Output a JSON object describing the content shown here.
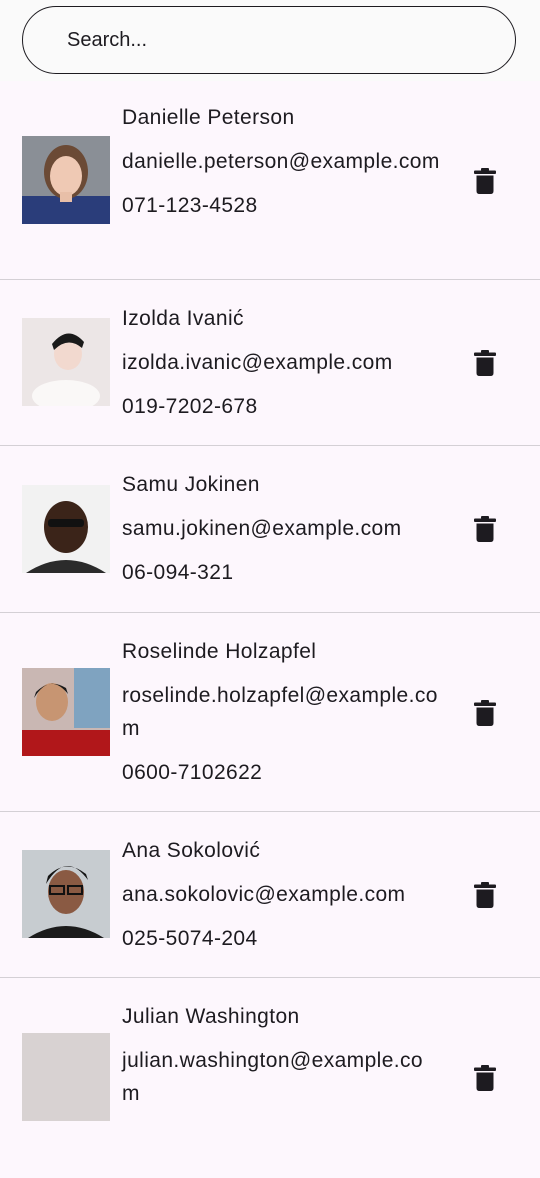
{
  "search": {
    "placeholder": "Search..."
  },
  "contacts": [
    {
      "name": "Danielle Peterson",
      "email": "danielle.peterson@example.com",
      "phone": "071-123-4528"
    },
    {
      "name": "Izolda Ivanić",
      "email": "izolda.ivanic@example.com",
      "phone": "019-7202-678"
    },
    {
      "name": "Samu Jokinen",
      "email": "samu.jokinen@example.com",
      "phone": "06-094-321"
    },
    {
      "name": "Roselinde Holzapfel",
      "email": "roselinde.holzapfel@example.com",
      "phone": "0600-7102622"
    },
    {
      "name": "Ana Sokolović",
      "email": "ana.sokolovic@example.com",
      "phone": "025-5074-204"
    },
    {
      "name": "Julian Washington",
      "email": "julian.washington@example.com",
      "phone": ""
    }
  ],
  "icons": {
    "row_action": "trash-icon",
    "avatar": "user-photo"
  }
}
